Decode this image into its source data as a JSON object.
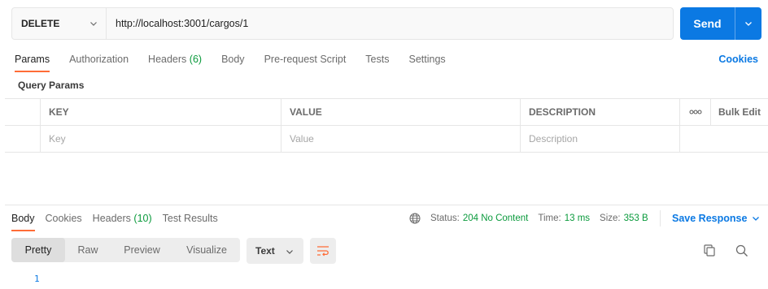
{
  "request": {
    "method": "DELETE",
    "url": "http://localhost:3001/cargos/1",
    "send_label": "Send"
  },
  "request_tabs": [
    {
      "label": "Params",
      "active": true
    },
    {
      "label": "Authorization"
    },
    {
      "label": "Headers",
      "count": "(6)"
    },
    {
      "label": "Body"
    },
    {
      "label": "Pre-request Script"
    },
    {
      "label": "Tests"
    },
    {
      "label": "Settings"
    }
  ],
  "cookies_link": "Cookies",
  "query_params": {
    "title": "Query Params",
    "headers": {
      "key": "KEY",
      "value": "VALUE",
      "description": "DESCRIPTION",
      "bulk_edit": "Bulk Edit"
    },
    "placeholders": {
      "key": "Key",
      "value": "Value",
      "description": "Description"
    }
  },
  "response_tabs": [
    {
      "label": "Body",
      "active": true
    },
    {
      "label": "Cookies"
    },
    {
      "label": "Headers",
      "count": "(10)"
    },
    {
      "label": "Test Results"
    }
  ],
  "response_meta": {
    "status_label": "Status:",
    "status_value": "204 No Content",
    "time_label": "Time:",
    "time_value": "13 ms",
    "size_label": "Size:",
    "size_value": "353 B",
    "save_response": "Save Response"
  },
  "view_modes": [
    "Pretty",
    "Raw",
    "Preview",
    "Visualize"
  ],
  "format": "Text",
  "line_numbers": [
    "1"
  ],
  "colors": {
    "accent": "#0b79e3",
    "tab_indicator": "#ff6c37",
    "success": "#0a9a3c"
  },
  "icons": [
    "chevron-down-icon",
    "globe-icon",
    "more-icon",
    "wrap-lines-icon",
    "copy-icon",
    "search-icon"
  ]
}
